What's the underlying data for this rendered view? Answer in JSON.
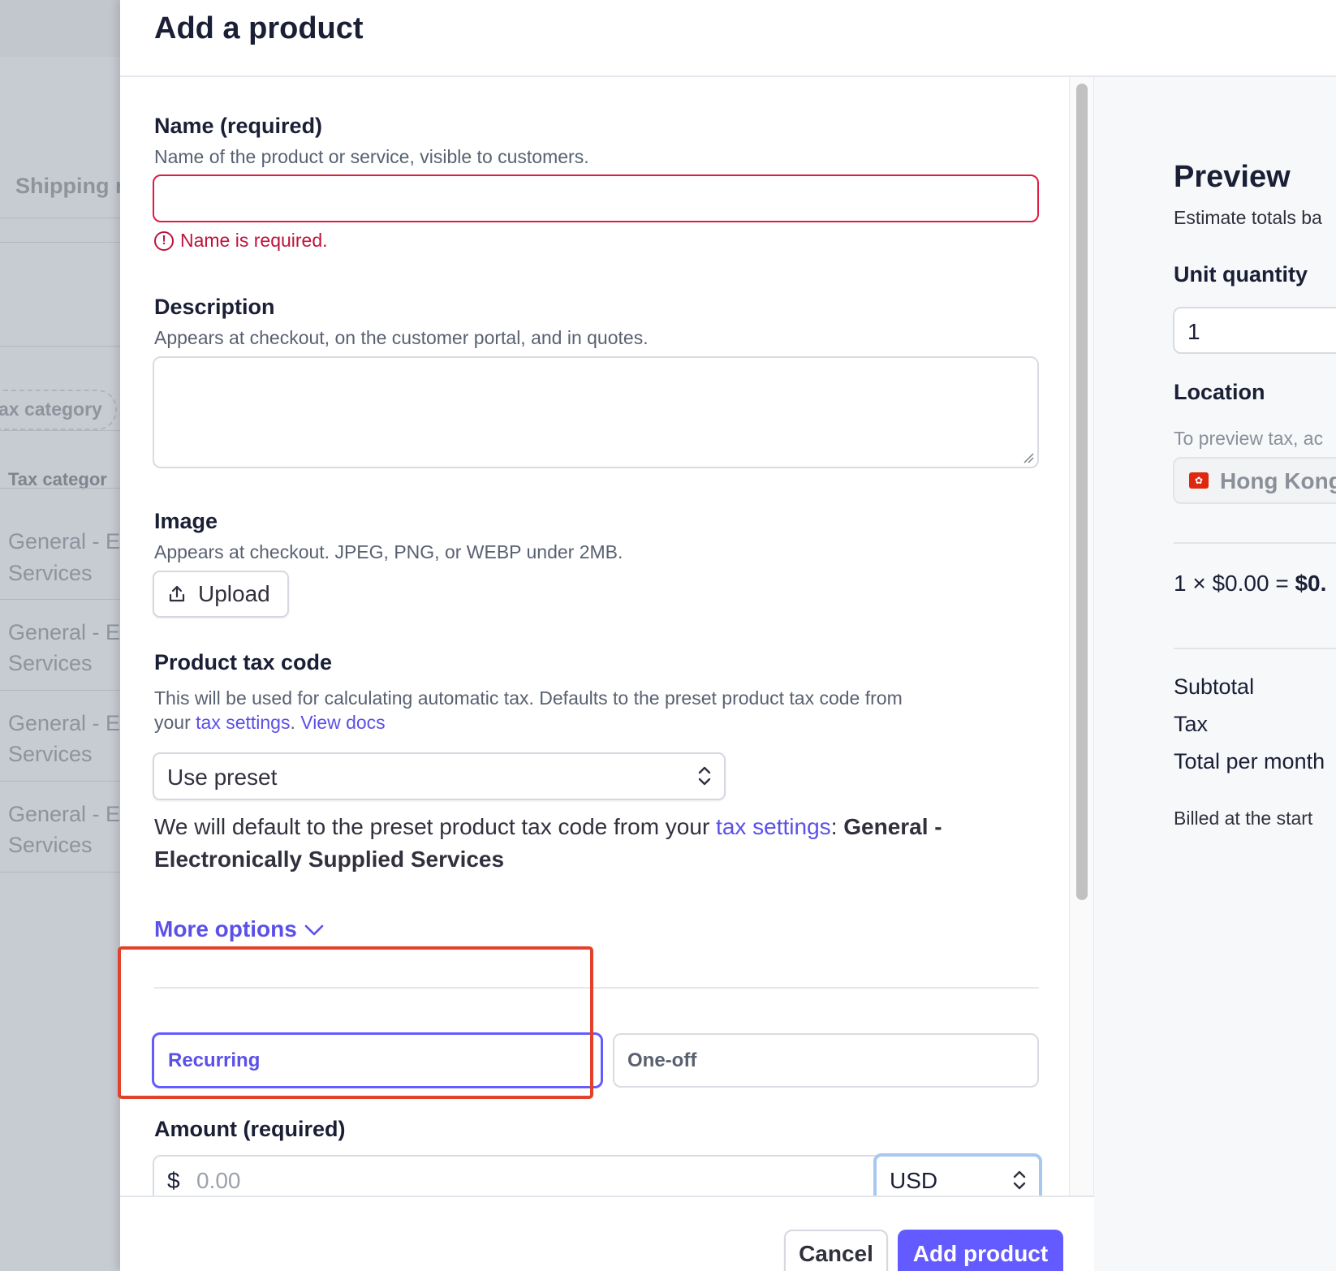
{
  "background": {
    "shipping_label": "Shipping r",
    "tax_category_pill": "ax category",
    "tax_category_header": "Tax categor",
    "rows": [
      {
        "line1": "General - E",
        "line2": "Services"
      },
      {
        "line1": "General - E",
        "line2": "Services"
      },
      {
        "line1": "General - E",
        "line2": "Services"
      },
      {
        "line1": "General - E",
        "line2": "Services"
      }
    ]
  },
  "modal": {
    "title": "Add a product",
    "name": {
      "label": "Name (required)",
      "help": "Name of the product or service, visible to customers.",
      "value": "",
      "error": "Name is required."
    },
    "description": {
      "label": "Description",
      "help": "Appears at checkout, on the customer portal, and in quotes.",
      "value": ""
    },
    "image": {
      "label": "Image",
      "help": "Appears at checkout. JPEG, PNG, or WEBP under 2MB.",
      "upload_label": "Upload"
    },
    "tax_code": {
      "label": "Product tax code",
      "help_prefix": "This will be used for calculating automatic tax. Defaults to the preset product tax code from",
      "help_your": "your ",
      "help_link": "tax settings",
      "help_dot": ".",
      "docs_link": "View docs",
      "select_value": "Use preset",
      "note_prefix": "We will default to the preset product tax code from your ",
      "note_link": "tax settings",
      "note_colon": ": ",
      "note_bold": "General - Electronically Supplied Services"
    },
    "more_options": "More options",
    "pricing_type": {
      "recurring": "Recurring",
      "one_off": "One-off",
      "selected": "Recurring"
    },
    "amount": {
      "label": "Amount (required)",
      "currency_symbol": "$",
      "placeholder": "0.00",
      "currency": "USD"
    },
    "footer": {
      "cancel": "Cancel",
      "submit": "Add product"
    }
  },
  "preview": {
    "title": "Preview",
    "subtitle": "Estimate totals ba",
    "unit_quantity_label": "Unit quantity",
    "unit_quantity_value": "1",
    "location_label": "Location",
    "location_help": "To preview tax, ac",
    "location_value": "Hong Kong",
    "calc_prefix": "1 × $0.00 = ",
    "calc_result": "$0.",
    "subtotal": "Subtotal",
    "tax": "Tax",
    "total_per_month": "Total per month",
    "billed": "Billed at the start"
  },
  "colors": {
    "accent": "#635bff",
    "error": "#df1b41",
    "highlight_annotation": "#e2422b"
  },
  "icons": {
    "error": "exclamation-circle-icon",
    "upload": "upload-icon",
    "select": "chevron-up-down-icon",
    "more": "chevron-down-icon",
    "flag": "hong-kong-flag-icon"
  }
}
